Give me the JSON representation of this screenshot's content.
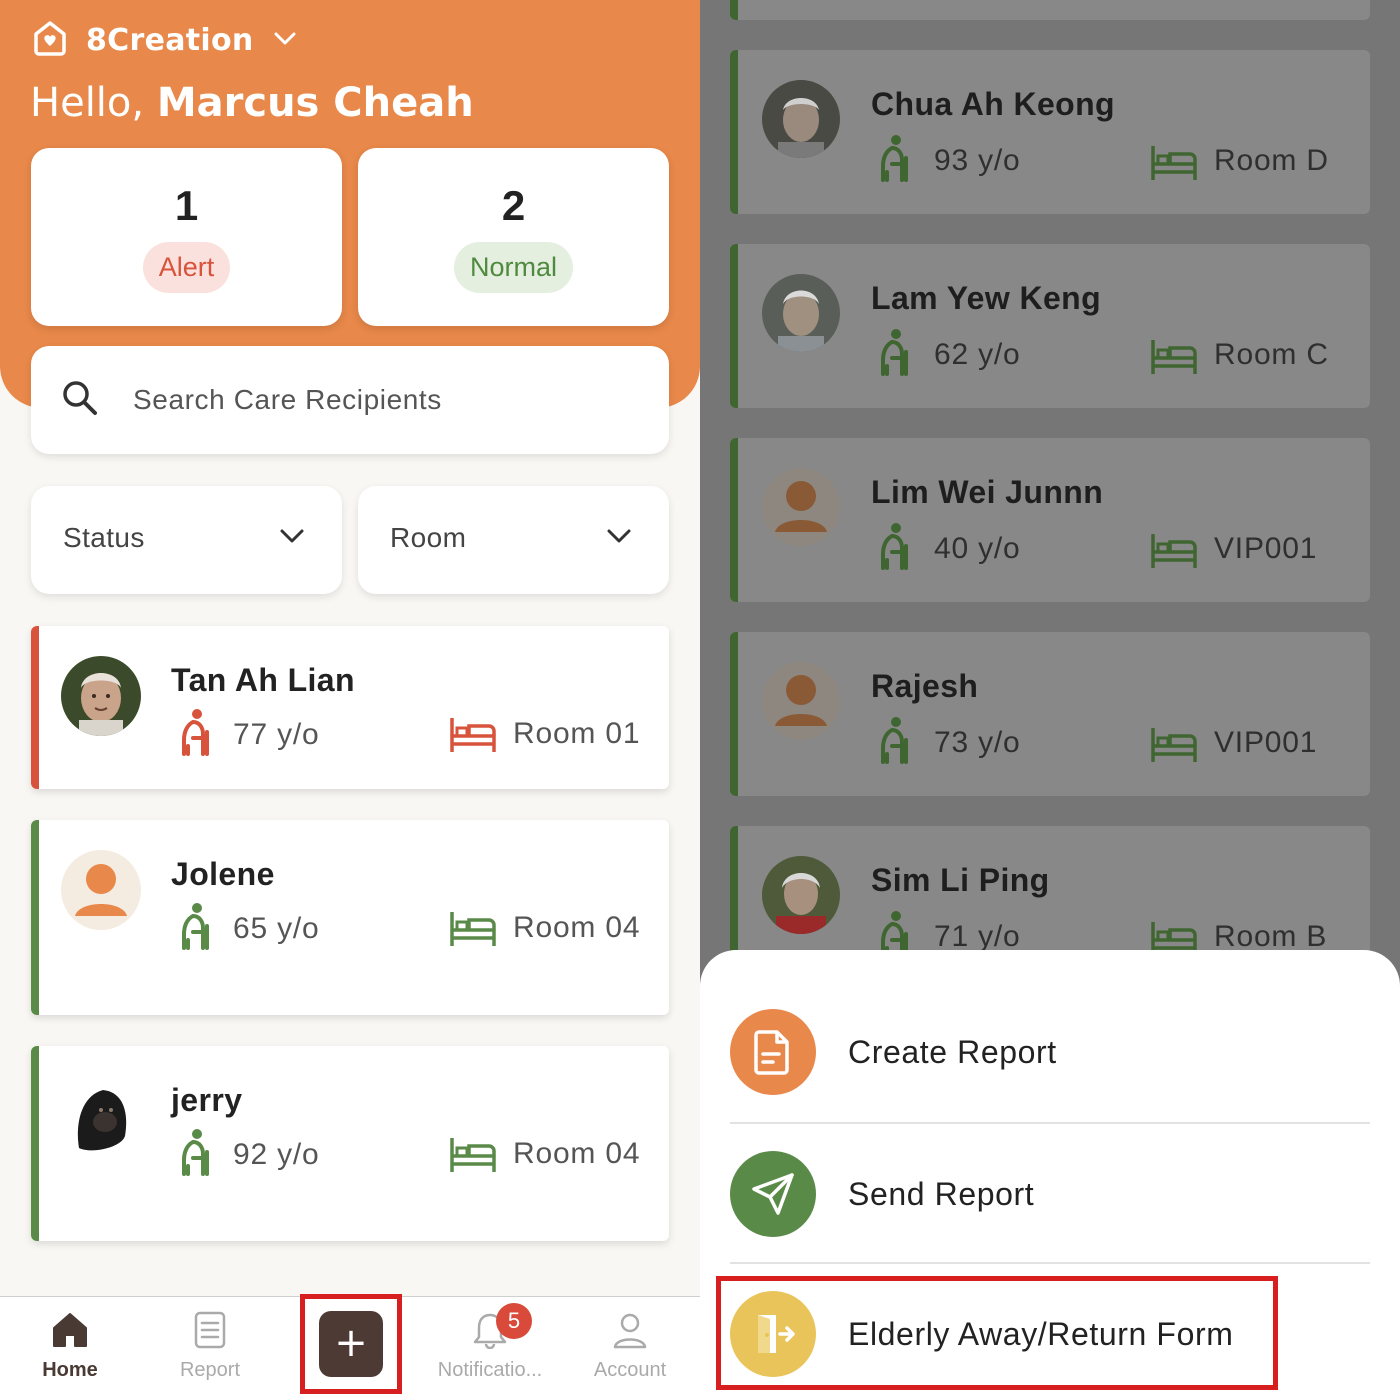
{
  "header": {
    "org_name": "8Creation",
    "greeting_prefix": "Hello,",
    "user_name": "Marcus Cheah",
    "accent_color": "#e8884a"
  },
  "stats": {
    "alert": {
      "count": "1",
      "label": "Alert",
      "color": "#d8533c"
    },
    "normal": {
      "count": "2",
      "label": "Normal",
      "color": "#4f8a3f"
    }
  },
  "search": {
    "placeholder": "Search Care Recipients",
    "value": ""
  },
  "filters": {
    "status": {
      "label": "Status"
    },
    "room": {
      "label": "Room"
    }
  },
  "recipients": [
    {
      "name": "Tan Ah Lian",
      "age": "77 y/o",
      "room": "Room 01",
      "status": "alert"
    },
    {
      "name": "Jolene",
      "age": "65 y/o",
      "room": "Room 04",
      "status": "normal"
    },
    {
      "name": "jerry",
      "age": "92 y/o",
      "room": "Room 04",
      "status": "normal"
    }
  ],
  "background_list": [
    {
      "name": "Chua Ah Keong",
      "age": "93 y/o",
      "room": "Room D"
    },
    {
      "name": "Lam Yew Keng",
      "age": "62 y/o",
      "room": "Room C"
    },
    {
      "name": "Lim Wei Junnn",
      "age": "40 y/o",
      "room": "VIP001"
    },
    {
      "name": "Rajesh",
      "age": "73 y/o",
      "room": "VIP001"
    },
    {
      "name": "Sim Li Ping",
      "age": "71 y/o",
      "room": "Room B"
    }
  ],
  "bottom_nav": {
    "home": "Home",
    "report": "Report",
    "add": "+",
    "notifications": "Notificatio...",
    "notifications_badge": "5",
    "account": "Account"
  },
  "action_sheet": {
    "create_report": "Create Report",
    "send_report": "Send Report",
    "away_return_form": "Elderly Away/Return Form"
  }
}
